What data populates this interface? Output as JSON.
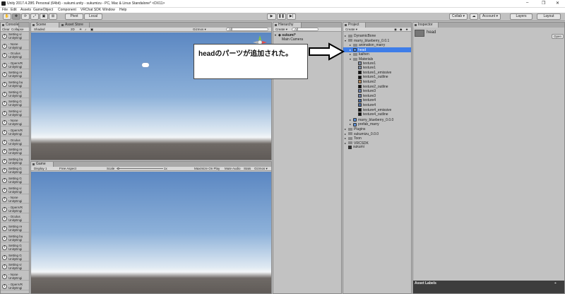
{
  "window": {
    "title": "Unity 2017.4.28f1 Personal (64bit) - sukumi.unity - sukumizu - PC, Mac & Linux Standalone* <DX11>",
    "controls": [
      "–",
      "❐",
      "✕"
    ]
  },
  "menu": [
    "File",
    "Edit",
    "Assets",
    "GameObject",
    "Component",
    "VRChat SDK",
    "Window",
    "Help"
  ],
  "toolbar": {
    "pivot": "Pivot",
    "local": "Local",
    "collab": "Collab ▾",
    "account": "Account ▾",
    "layers": "Layers",
    "layout": "Layout"
  },
  "console": {
    "tab": "Console",
    "clear": "Clear",
    "collapse": "Collapse",
    "rows": [
      {
        "l1": "Setting vi",
        "l2": "UnityEngi"
      },
      {
        "l1": "- None",
        "l2": "UnityEngi"
      },
      {
        "l1": "- Oculus",
        "l2": "UnityEngi"
      },
      {
        "l1": "- OpenVR",
        "l2": "UnityEngi"
      },
      {
        "l1": "Setting re",
        "l2": "UnityEngi"
      },
      {
        "l1": "Setting bu",
        "l2": "UnityEngi"
      },
      {
        "l1": "Setting G",
        "l2": "UnityEngi"
      },
      {
        "l1": "Setting G",
        "l2": "UnityEngi"
      },
      {
        "l1": "Setting vi",
        "l2": "UnityEngi"
      },
      {
        "l1": "- None",
        "l2": "UnityEngi"
      },
      {
        "l1": "- OpenVR",
        "l2": "UnityEngi"
      },
      {
        "l1": "- Oculus",
        "l2": "UnityEngi"
      },
      {
        "l1": "Setting re",
        "l2": "UnityEngi"
      },
      {
        "l1": "Setting bu",
        "l2": "UnityEngi"
      },
      {
        "l1": "Setting G",
        "l2": "UnityEngi"
      },
      {
        "l1": "Setting G",
        "l2": "UnityEngi"
      },
      {
        "l1": "Setting vi",
        "l2": "UnityEngi"
      },
      {
        "l1": "- None",
        "l2": "UnityEngi"
      },
      {
        "l1": "- OpenVR",
        "l2": "UnityEngi"
      },
      {
        "l1": "- Oculus",
        "l2": "UnityEngi"
      },
      {
        "l1": "Setting re",
        "l2": "UnityEngi"
      },
      {
        "l1": "Setting bu",
        "l2": "UnityEngi"
      },
      {
        "l1": "Setting G",
        "l2": "UnityEngi"
      },
      {
        "l1": "Setting G",
        "l2": "UnityEngi"
      },
      {
        "l1": "Setting vi",
        "l2": "UnityEngi"
      },
      {
        "l1": "- None",
        "l2": "UnityEngi"
      },
      {
        "l1": "- OpenVR",
        "l2": "UnityEngi"
      }
    ]
  },
  "scene": {
    "tab_scene": "Scene",
    "tab_asset_store": "Asset Store",
    "shading": "Shaded",
    "mode2d": "2D",
    "gizmos": "Gizmos ▾",
    "search": "All"
  },
  "game": {
    "tab": "Game",
    "display": "Display 1",
    "aspect": "Free Aspect",
    "scale_label": "Scale",
    "scale_value": "1x",
    "maximize": "Maximize On Play",
    "mute": "Mute Audio",
    "stats": "Stats",
    "gizmos": "Gizmos ▾"
  },
  "hierarchy": {
    "tab": "Hierarchy",
    "create": "Create ▾",
    "search": "All",
    "scene_name": "sukumi*",
    "items": [
      "Main Camera"
    ]
  },
  "project": {
    "tab": "Project",
    "create": "Create ▾",
    "tree": [
      {
        "label": "DynamicBone",
        "indent": 0,
        "kind": "folder",
        "arrow": "▸"
      },
      {
        "label": "marry_blueberry_0.0.1",
        "indent": 0,
        "kind": "folder",
        "arrow": "▾"
      },
      {
        "label": "animation_marry",
        "indent": 1,
        "kind": "folder",
        "arrow": "▸"
      },
      {
        "label": "head",
        "indent": 1,
        "kind": "mesh",
        "arrow": "▸",
        "selected": true
      },
      {
        "label": "kaihen",
        "indent": 1,
        "kind": "folder",
        "arrow": "▸"
      },
      {
        "label": "Materials",
        "indent": 1,
        "kind": "folder",
        "arrow": "▾"
      },
      {
        "label": "texture1",
        "indent": 2,
        "kind": "tex",
        "color": "#7f8fa8"
      },
      {
        "label": "texture1",
        "indent": 2,
        "kind": "tex",
        "color": "#7f8fa8"
      },
      {
        "label": "texture1_emissive",
        "indent": 2,
        "kind": "tex",
        "color": "#111111"
      },
      {
        "label": "texture1_outline",
        "indent": 2,
        "kind": "tex",
        "color": "#111111"
      },
      {
        "label": "texture2",
        "indent": 2,
        "kind": "tex",
        "color": "#b88a5a"
      },
      {
        "label": "texture2_outline",
        "indent": 2,
        "kind": "tex",
        "color": "#111111"
      },
      {
        "label": "texture3",
        "indent": 2,
        "kind": "tex",
        "color": "#6b7fa8"
      },
      {
        "label": "texture3",
        "indent": 2,
        "kind": "tex",
        "color": "#6b7fa8"
      },
      {
        "label": "texture4",
        "indent": 2,
        "kind": "tex",
        "color": "#4a6aa0"
      },
      {
        "label": "texture4",
        "indent": 2,
        "kind": "tex",
        "color": "#4a6aa0"
      },
      {
        "label": "texture4_emissive",
        "indent": 2,
        "kind": "tex",
        "color": "#111111"
      },
      {
        "label": "texture4_outline",
        "indent": 2,
        "kind": "tex",
        "color": "#111111"
      },
      {
        "label": "marry_blueberry_0.0.0",
        "indent": 1,
        "kind": "mesh",
        "arrow": "▸"
      },
      {
        "label": "prefab_marry",
        "indent": 1,
        "kind": "mesh",
        "arrow": "▸"
      },
      {
        "label": "Plugins",
        "indent": 0,
        "kind": "folder",
        "arrow": "▸"
      },
      {
        "label": "sukumizu_0.0.0",
        "indent": 0,
        "kind": "folder",
        "arrow": "▸"
      },
      {
        "label": "Toon",
        "indent": 0,
        "kind": "folder",
        "arrow": "▸"
      },
      {
        "label": "VRCSDK",
        "indent": 0,
        "kind": "folder",
        "arrow": "▸"
      },
      {
        "label": "sukumi",
        "indent": 0,
        "kind": "unity",
        "arrow": ""
      }
    ]
  },
  "inspector": {
    "tab": "Inspector",
    "object": "head",
    "open": "Open",
    "asset_labels": "Asset Labels"
  },
  "annotation": {
    "text": "headのパーツが追加された。"
  },
  "colors": {
    "selection": "#3e7de8",
    "panel": "#c2c2c2",
    "tab_active": "#cbcbcb"
  }
}
